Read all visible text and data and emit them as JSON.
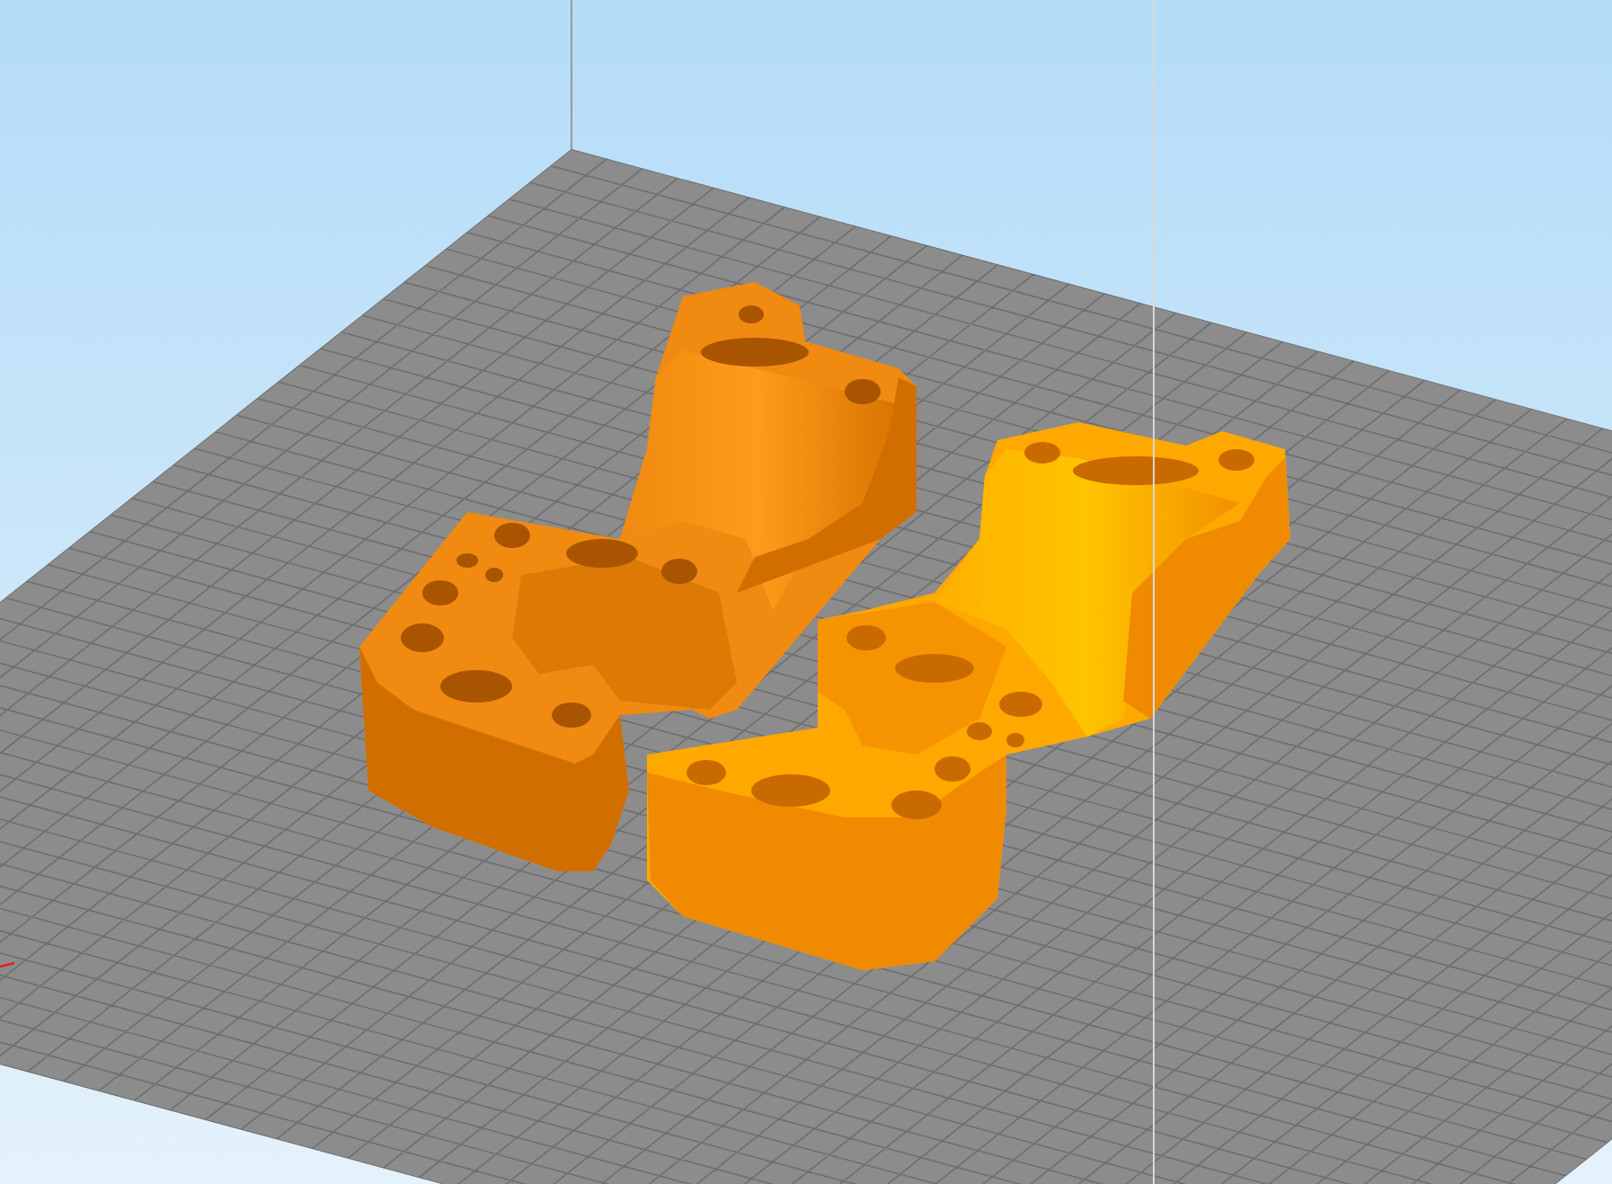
{
  "viewport": {
    "objects": [
      {
        "selected": false
      },
      {
        "selected": true
      }
    ]
  }
}
